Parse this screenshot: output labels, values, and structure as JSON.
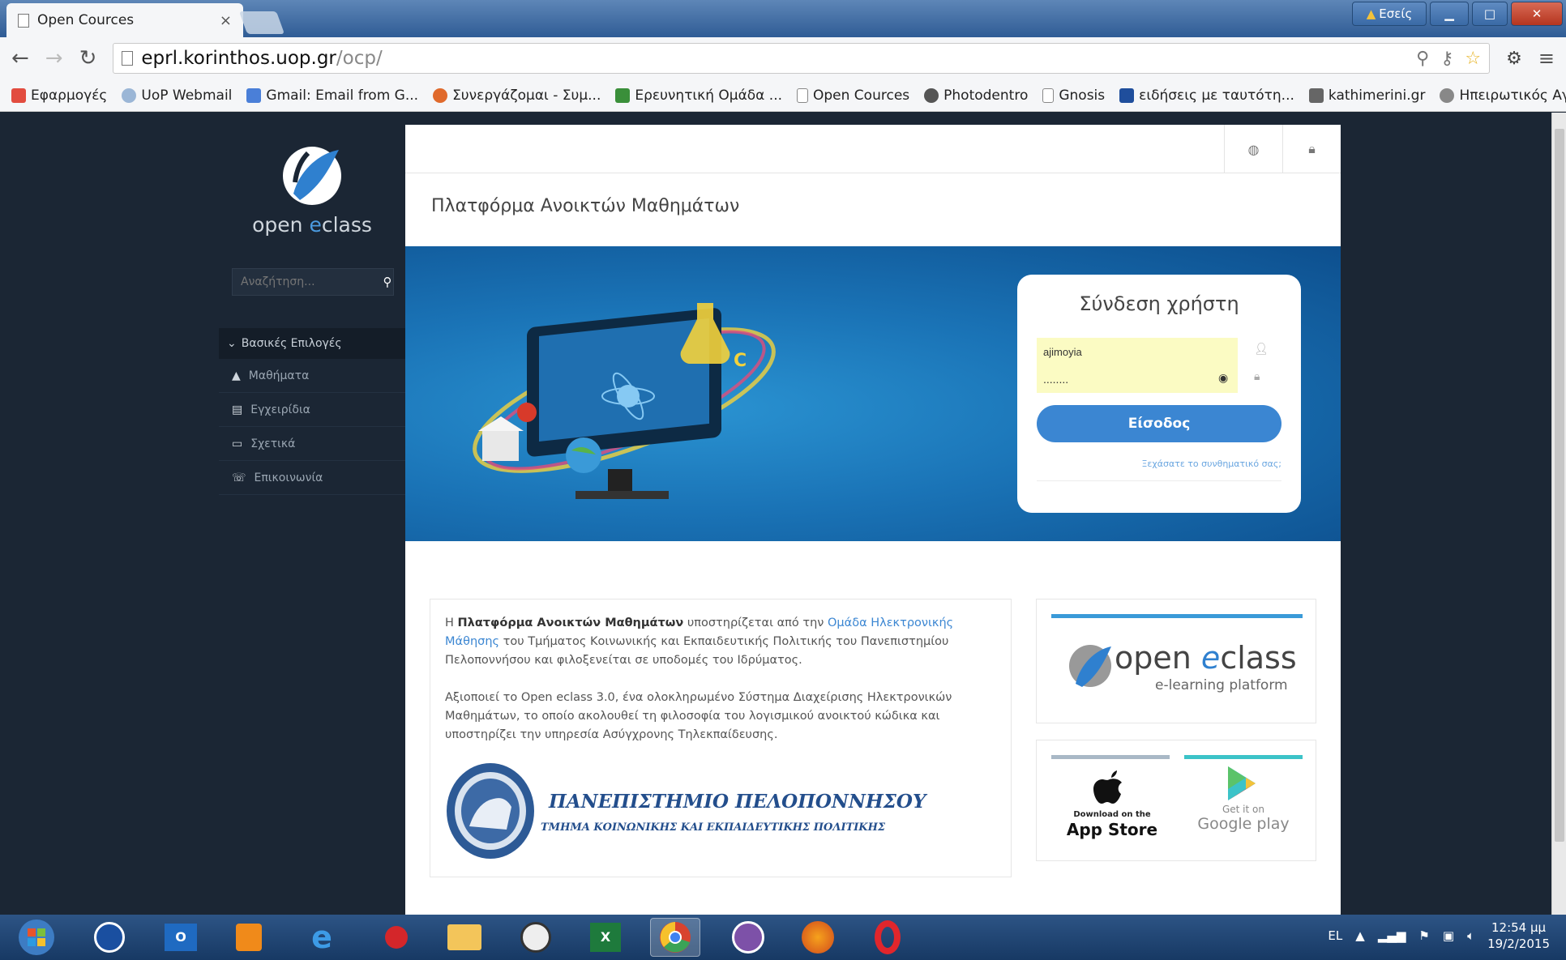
{
  "browser": {
    "tab_title": "Open Cources",
    "tab_close": "×",
    "url_host": "eprl.korinthos.uop.gr",
    "url_path": "/ocp/",
    "user_badge": "Εσείς",
    "bookmarks": [
      {
        "label": "Εφαρμογές",
        "color": "#e24c3f"
      },
      {
        "label": "UoP Webmail",
        "color": "#9bb6d6"
      },
      {
        "label": "Gmail: Email from G...",
        "color": "#4a7fd8"
      },
      {
        "label": "Συνεργάζομαι - Συμ...",
        "color": "#e06a2c"
      },
      {
        "label": "Ερευνητική Ομάδα ...",
        "color": "#3a8f3a"
      },
      {
        "label": "Open Cources",
        "color": "#dddddd"
      },
      {
        "label": "Photodentro",
        "color": "#555555"
      },
      {
        "label": "Gnosis",
        "color": "#dddddd"
      },
      {
        "label": "ειδήσεις με ταυτότη...",
        "color": "#1f4e9c"
      },
      {
        "label": "kathimerini.gr",
        "color": "#666666"
      },
      {
        "label": "Ηπειρωτικός Αγών",
        "color": "#888888"
      }
    ],
    "bookmarks_more": "»"
  },
  "sidebar": {
    "logo_text_a": "open ",
    "logo_text_b": "e",
    "logo_text_c": "class",
    "search_placeholder": "Αναζήτηση...",
    "menu_header": "Βασικές Επιλογές",
    "items": [
      {
        "label": "Μαθήματα",
        "icon": "graduation-cap-icon",
        "glyph": "🎓"
      },
      {
        "label": "Εγχειρίδια",
        "icon": "document-icon",
        "glyph": "▤"
      },
      {
        "label": "Σχετικά",
        "icon": "credit-card-icon",
        "glyph": "▭"
      },
      {
        "label": "Επικοινωνία",
        "icon": "phone-icon",
        "glyph": "☏"
      }
    ]
  },
  "main": {
    "page_title": "Πλατφόρμα Ανοικτών Μαθημάτων",
    "login": {
      "title": "Σύνδεση χρήστη",
      "username": "ajimoyia",
      "password": "........",
      "button": "Είσοδος",
      "forgot": "Ξεχάσατε το συνθηματικό σας;"
    },
    "info": {
      "p1_a": "Η ",
      "p1_b": "Πλατφόρμα Ανοικτών Μαθημάτων",
      "p1_c": " υποστηρίζεται από την ",
      "p1_link": "Ομάδα Ηλεκτρονικής Μάθησης",
      "p1_d": " του Τμήματος Κοινωνικής και Εκπαιδευτικής Πολιτικής του Πανεπιστημίου Πελοποννήσου και φιλοξενείται σε υποδομές του Ιδρύματος.",
      "p2": "Αξιοποιεί το Open eclass 3.0, ένα ολοκληρωμένο Σύστημα Διαχείρισης Ηλεκτρονικών Μαθημάτων, το οποίο ακολουθεί τη φιλοσοφία του λογισμικού ανοικτού κώδικα και υποστηρίζει την υπηρεσία Ασύγχρονης Τηλεκπαίδευσης.",
      "uni_name": "ΠΑΝΕΠΙΣΤΗΜΙΟ ΠΕΛΟΠΟΝΝΗΣΟΥ",
      "uni_dept": "ΤΜΗΜΑ ΚΟΙΝΩΝΙΚΗΣ ΚΑΙ ΕΚΠΑΙΔΕΥΤΙΚΗΣ ΠΟΛΙΤΙΚΗΣ"
    },
    "brand": {
      "name_a": "open ",
      "name_b": "e",
      "name_c": "class",
      "tagline": "e-learning platform"
    },
    "stores": {
      "apple_small": "Download on the",
      "apple_big": "App Store",
      "google_small": "Get it on",
      "google_big": "Google play"
    }
  },
  "taskbar": {
    "lang": "EL",
    "time": "12:54 μμ",
    "date": "19/2/2015"
  },
  "colors": {
    "accent": "#3b86d2",
    "sidebar_bg": "#1b2634",
    "autofill": "#fbfbc3"
  }
}
